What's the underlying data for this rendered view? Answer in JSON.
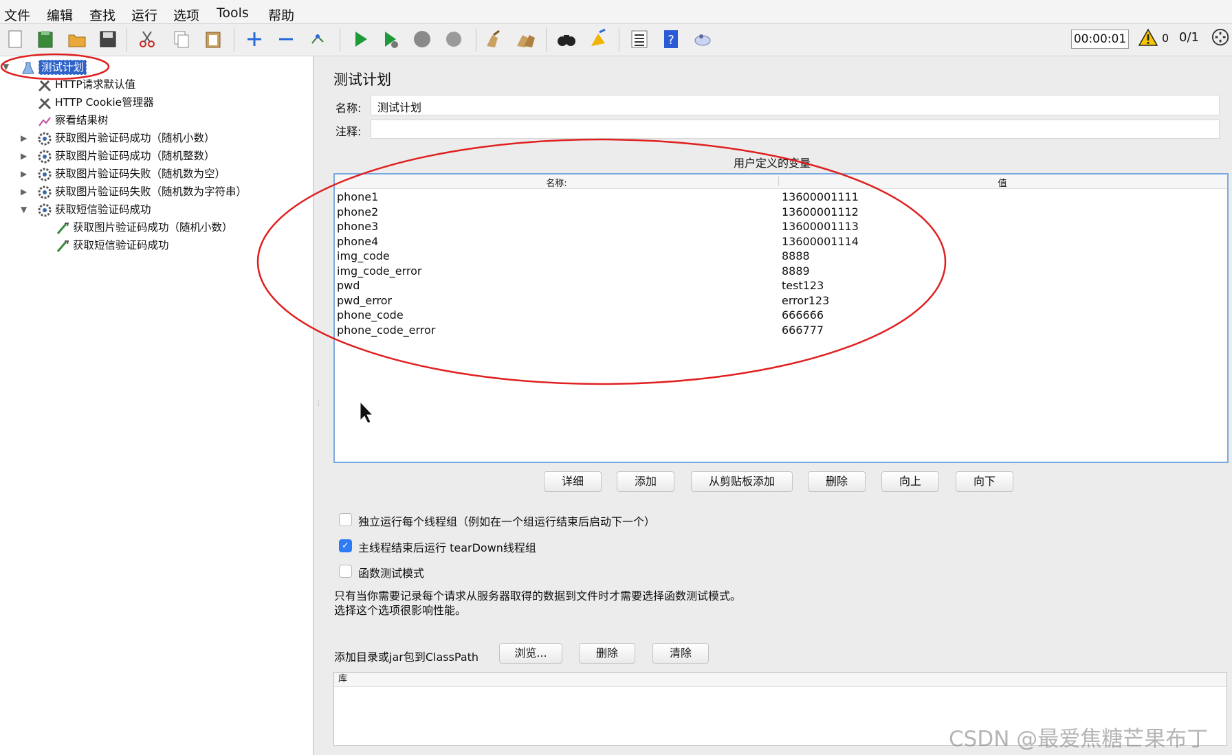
{
  "menu": [
    "文件",
    "编辑",
    "查找",
    "运行",
    "选项",
    "Tools",
    "帮助"
  ],
  "toolbar": {
    "icons": [
      "new-icon",
      "template-icon",
      "open-icon",
      "save-icon",
      "cut-icon",
      "copy-icon",
      "paste-icon",
      "expand-icon",
      "collapse-icon",
      "toggle-icon",
      "start-icon",
      "start-no-pauses-icon",
      "stop-icon",
      "shutdown-icon",
      "clear-icon",
      "clear-all-icon",
      "search-icon",
      "reset-search-icon",
      "function-helper-icon",
      "help-icon",
      "remote-icon"
    ],
    "timer": "00:00:01",
    "warning_count": "0",
    "threads": "0/1"
  },
  "tree": [
    {
      "label": "测试计划",
      "icon": "test-plan-icon",
      "selected": true
    },
    {
      "label": "HTTP请求默认值",
      "icon": "config-element-icon"
    },
    {
      "label": "HTTP Cookie管理器",
      "icon": "config-element-icon"
    },
    {
      "label": "察看结果树",
      "icon": "listener-icon"
    },
    {
      "label": "获取图片验证码成功（随机小数）",
      "icon": "thread-group-icon"
    },
    {
      "label": "获取图片验证码成功（随机整数）",
      "icon": "thread-group-icon"
    },
    {
      "label": "获取图片验证码失败（随机数为空）",
      "icon": "thread-group-icon"
    },
    {
      "label": "获取图片验证码失败（随机数为字符串）",
      "icon": "thread-group-icon"
    },
    {
      "label": "获取短信验证码成功",
      "icon": "thread-group-icon"
    },
    {
      "label": "获取图片验证码成功（随机小数）",
      "icon": "sampler-icon"
    },
    {
      "label": "获取短信验证码成功",
      "icon": "sampler-icon"
    }
  ],
  "panel": {
    "title": "测试计划",
    "name_label": "名称:",
    "name_value": "测试计划",
    "comment_label": "注释:",
    "comment_value": "",
    "vars_title": "用户定义的变量",
    "col_name": "名称:",
    "col_value": "值",
    "variables": [
      {
        "name": "phone1",
        "value": "13600001111"
      },
      {
        "name": "phone2",
        "value": "13600001112"
      },
      {
        "name": "phone3",
        "value": "13600001113"
      },
      {
        "name": "phone4",
        "value": "13600001114"
      },
      {
        "name": "img_code",
        "value": "8888"
      },
      {
        "name": "img_code_error",
        "value": "8889"
      },
      {
        "name": "pwd",
        "value": "test123"
      },
      {
        "name": "pwd_error",
        "value": "error123"
      },
      {
        "name": "phone_code",
        "value": "666666"
      },
      {
        "name": "phone_code_error",
        "value": "666777"
      }
    ],
    "buttons": [
      "详细",
      "添加",
      "从剪贴板添加",
      "删除",
      "向上",
      "向下"
    ],
    "checkboxes": [
      {
        "label": "独立运行每个线程组（例如在一个组运行结束后启动下一个）",
        "checked": false
      },
      {
        "label": "主线程结束后运行 tearDown线程组",
        "checked": true
      },
      {
        "label": "函数测试模式",
        "checked": false
      }
    ],
    "note_line1": "只有当你需要记录每个请求从服务器取得的数据到文件时才需要选择函数测试模式。",
    "note_line2": "选择这个选项很影响性能。",
    "classpath_label": "添加目录或jar包到ClassPath",
    "classpath_buttons": [
      "浏览...",
      "删除",
      "清除"
    ],
    "lib_header": "库"
  },
  "watermark": "CSDN @最爱焦糖芒果布丁",
  "annotation_color": "#e02020"
}
